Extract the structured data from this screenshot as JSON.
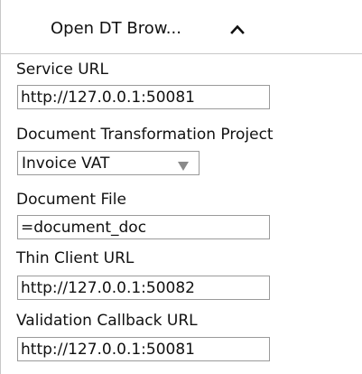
{
  "header": {
    "title": "Open DT Brow...",
    "caret_icon": "chevron-up-icon"
  },
  "fields": {
    "service_url": {
      "label": "Service URL",
      "value": "http://127.0.0.1:50081"
    },
    "project": {
      "label": "Document Transformation Project",
      "selected": "Invoice VAT",
      "arrow_icon": "dropdown-arrow-icon"
    },
    "document_file": {
      "label": "Document File",
      "value": "=document_doc"
    },
    "thin_client_url": {
      "label": "Thin Client URL",
      "value": "http://127.0.0.1:50082"
    },
    "validation_callback_url": {
      "label": "Validation Callback URL",
      "value": "http://127.0.0.1:50081"
    }
  },
  "colors": {
    "border": "#9a9a9a",
    "divider": "#c8c8c8",
    "arrow": "#8a8a8a",
    "text": "#111111"
  }
}
